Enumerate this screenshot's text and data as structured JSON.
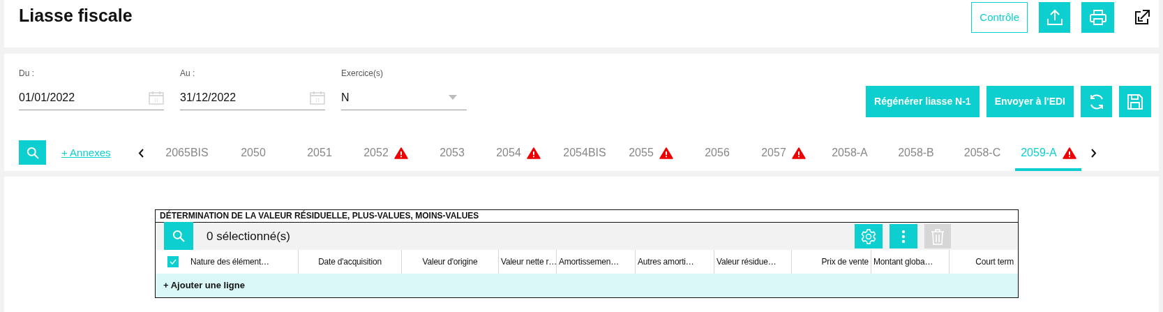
{
  "header": {
    "title": "Liasse fiscale",
    "control_button": "Contrôle"
  },
  "filters": {
    "fields": [
      {
        "label": "Du :",
        "value": "01/01/2022",
        "kind": "date"
      },
      {
        "label": "Au :",
        "value": "31/12/2022",
        "kind": "date"
      },
      {
        "label": "Exercice(s)",
        "value": "N",
        "kind": "select"
      }
    ],
    "buttons": [
      "Régénérer liasse N-1",
      "Envoyer à l'EDI"
    ]
  },
  "annexes_link": "+ Annexes",
  "tabs": [
    {
      "label": "2065BIS",
      "warning": false,
      "selected": false
    },
    {
      "label": "2050",
      "warning": false,
      "selected": false
    },
    {
      "label": "2051",
      "warning": false,
      "selected": false
    },
    {
      "label": "2052",
      "warning": true,
      "selected": false
    },
    {
      "label": "2053",
      "warning": false,
      "selected": false
    },
    {
      "label": "2054",
      "warning": true,
      "selected": false
    },
    {
      "label": "2054BIS",
      "warning": false,
      "selected": false
    },
    {
      "label": "2055",
      "warning": true,
      "selected": false
    },
    {
      "label": "2056",
      "warning": false,
      "selected": false
    },
    {
      "label": "2057",
      "warning": true,
      "selected": false
    },
    {
      "label": "2058-A",
      "warning": false,
      "selected": false
    },
    {
      "label": "2058-B",
      "warning": false,
      "selected": false
    },
    {
      "label": "2058-C",
      "warning": false,
      "selected": false
    },
    {
      "label": "2059-A",
      "warning": true,
      "selected": true
    }
  ],
  "table": {
    "title": "DÉTERMINATION DE LA VALEUR RÉSIDUELLE, PLUS-VALUES, MOINS-VALUES",
    "selection_count": "0 sélectionné(s)",
    "select_all": {
      "checked": true
    },
    "columns": [
      "Nature des élément…",
      "Date d'acquisition",
      "Valeur d'origine",
      "Valeur nette r…",
      "Amortissemen…",
      "Autres amorti…",
      "Valeur résidue…",
      "Prix de vente",
      "Montant globa…",
      "Court term"
    ],
    "add_row": "+ Ajouter une ligne"
  }
}
